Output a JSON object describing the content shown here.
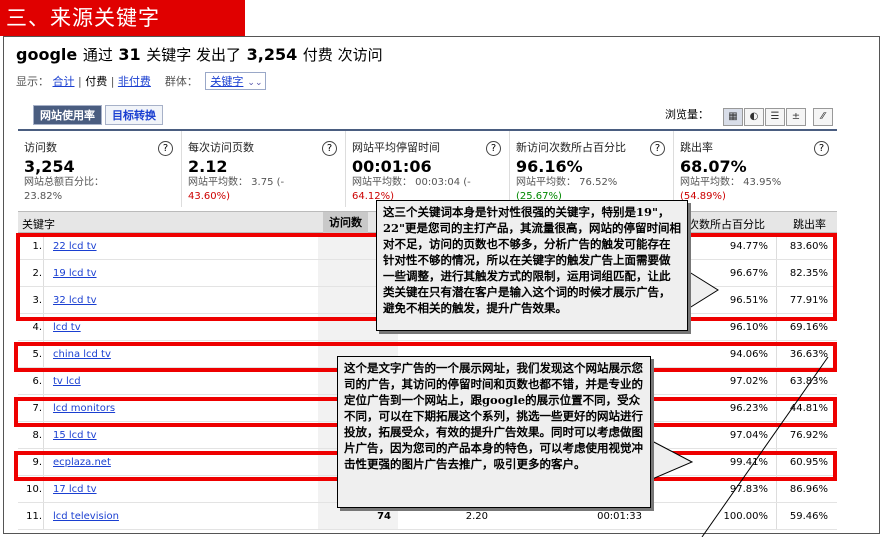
{
  "section_title": "三、来源关键字",
  "headline": {
    "source": "google",
    "text1": "通过",
    "count": "31",
    "text2": "关键字 发出了",
    "visits": "3,254",
    "text3": "付费 次访问"
  },
  "filters": {
    "display_label": "显示：",
    "total": "合计",
    "paid": "付费",
    "nonpaid": "非付费",
    "group_label": "群体：",
    "group_value": "关键字"
  },
  "tabs": [
    "网站使用率",
    "目标转换"
  ],
  "view_label": "浏览量：",
  "metrics": [
    {
      "label": "访问数",
      "value": "3,254",
      "sub1": "网站总额百分比：",
      "sub2": "23.82%",
      "sub2_style": ""
    },
    {
      "label": "每次访问页数",
      "value": "2.12",
      "sub1": "网站平均数： 3.75 (-",
      "sub2": "43.60%)",
      "sub2_style": "neg"
    },
    {
      "label": "网站平均停留时间",
      "value": "00:01:06",
      "sub1": "网站平均数： 00:03:04 (-",
      "sub2": "64.12%)",
      "sub2_style": "neg"
    },
    {
      "label": "新访问次数所占百分比",
      "value": "96.16%",
      "sub1": "网站平均数： 76.52%",
      "sub2": "(25.67%)",
      "sub2_style": "pos"
    },
    {
      "label": "跳出率",
      "value": "68.07%",
      "sub1": "网站平均数： 43.95%",
      "sub2": "(54.89%)",
      "sub2_style": "neg"
    }
  ],
  "table": {
    "headers": {
      "keyword": "关键字",
      "visits": "访问数",
      "new_pct": "次数所占百分比",
      "bounce": "跳出率"
    },
    "rows": [
      {
        "num": "1.",
        "keyword": "22 lcd tv",
        "visits": "",
        "pages": "",
        "time": "",
        "new_pct": "94.77%",
        "bounce": "83.60%"
      },
      {
        "num": "2.",
        "keyword": "19 lcd tv",
        "visits": "",
        "pages": "",
        "time": "",
        "new_pct": "96.67%",
        "bounce": "82.35%"
      },
      {
        "num": "3.",
        "keyword": "32 lcd tv",
        "visits": "",
        "pages": "",
        "time": "",
        "new_pct": "96.51%",
        "bounce": "77.91%"
      },
      {
        "num": "4.",
        "keyword": "lcd tv",
        "visits": "",
        "pages": "",
        "time": "",
        "new_pct": "96.10%",
        "bounce": "69.16%"
      },
      {
        "num": "5.",
        "keyword": "china lcd tv",
        "visits": "",
        "pages": "",
        "time": "",
        "new_pct": "94.06%",
        "bounce": "36.63%"
      },
      {
        "num": "6.",
        "keyword": "tv lcd",
        "visits": "",
        "pages": "",
        "time": "",
        "new_pct": "97.02%",
        "bounce": "63.83%"
      },
      {
        "num": "7.",
        "keyword": "lcd monitors",
        "visits": "",
        "pages": "",
        "time": "",
        "new_pct": "96.23%",
        "bounce": "44.81%"
      },
      {
        "num": "8.",
        "keyword": "15 lcd tv",
        "visits": "",
        "pages": "",
        "time": "",
        "new_pct": "97.04%",
        "bounce": "76.92%"
      },
      {
        "num": "9.",
        "keyword": "ecplaza.net",
        "visits": "",
        "pages": "",
        "time": "",
        "new_pct": "99.41%",
        "bounce": "60.95%"
      },
      {
        "num": "10.",
        "keyword": "17 lcd tv",
        "visits": "",
        "pages": "",
        "time": "",
        "new_pct": "97.83%",
        "bounce": "86.96%"
      },
      {
        "num": "11.",
        "keyword": "lcd television",
        "visits": "74",
        "pages": "2.20",
        "time": "00:01:33",
        "new_pct": "100.00%",
        "bounce": "59.46%"
      }
    ]
  },
  "callouts": {
    "top": "这三个关键词本身是针对性很强的关键字，特别是19\"，22\"更是您司的主打产品，其流量很高，网站的停留时间相对不足，访问的页数也不够多，分析广告的触发可能存在针对性不够的情况，所以在关键字的触发广告上面需要做一些调整，进行其触发方式的限制，运用词组匹配，让此类关键在只有潜在客户是输入这个词的时候才展示广告，避免不相关的触发，提升广告效果。",
    "bottom": "这个是文字广告的一个展示网址，我们发现这个网站展示您司的广告，其访问的停留时间和页数也都不错，并是专业的定位广告到一个网站上，跟google的展示位置不同，受众不同，可以在下期拓展这个系列，挑选一些更好的网站进行投放，拓展受众，有效的提升广告效果。同时可以考虑做图片广告，因为您司的产品本身的特色，可以考虑使用视觉冲击性更强的图片广告去推广，吸引更多的客户。"
  }
}
